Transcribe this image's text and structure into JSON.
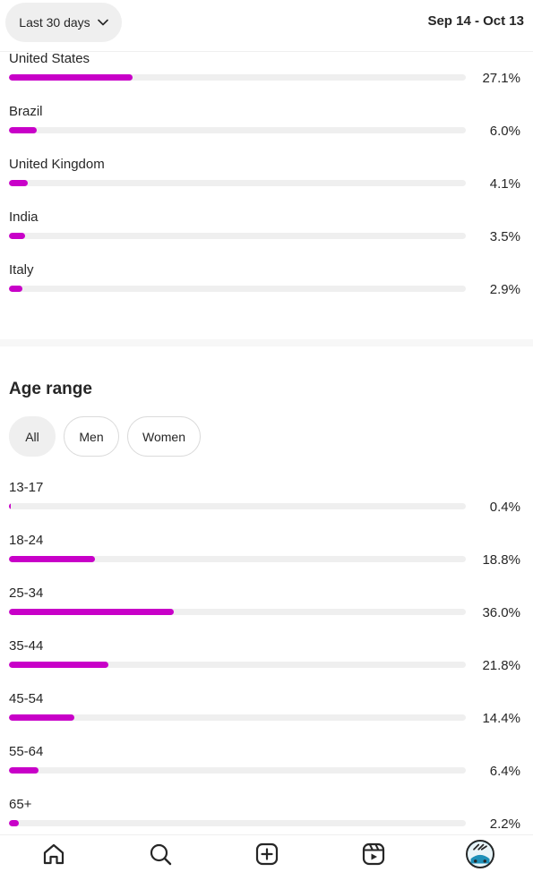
{
  "header": {
    "range_label": "Last 30 days",
    "date_span": "Sep 14 - Oct 13"
  },
  "countries": [
    {
      "label": "United States",
      "percent": "27.1%",
      "value": 27.1
    },
    {
      "label": "Brazil",
      "percent": "6.0%",
      "value": 6.0
    },
    {
      "label": "United Kingdom",
      "percent": "4.1%",
      "value": 4.1
    },
    {
      "label": "India",
      "percent": "3.5%",
      "value": 3.5
    },
    {
      "label": "Italy",
      "percent": "2.9%",
      "value": 2.9
    }
  ],
  "age_section": {
    "title": "Age range",
    "filters": [
      "All",
      "Men",
      "Women"
    ],
    "selected_filter": "All"
  },
  "ages": [
    {
      "label": "13-17",
      "percent": "0.4%",
      "value": 0.4
    },
    {
      "label": "18-24",
      "percent": "18.8%",
      "value": 18.8
    },
    {
      "label": "25-34",
      "percent": "36.0%",
      "value": 36.0
    },
    {
      "label": "35-44",
      "percent": "21.8%",
      "value": 21.8
    },
    {
      "label": "45-54",
      "percent": "14.4%",
      "value": 14.4
    },
    {
      "label": "55-64",
      "percent": "6.4%",
      "value": 6.4
    },
    {
      "label": "65+",
      "percent": "2.2%",
      "value": 2.2
    }
  ],
  "colors": {
    "bar_fill": "#c800c8",
    "bar_track": "#efefef",
    "text": "#262626"
  },
  "nav_icons": [
    "home-icon",
    "search-icon",
    "create-icon",
    "reels-icon",
    "profile-avatar"
  ]
}
